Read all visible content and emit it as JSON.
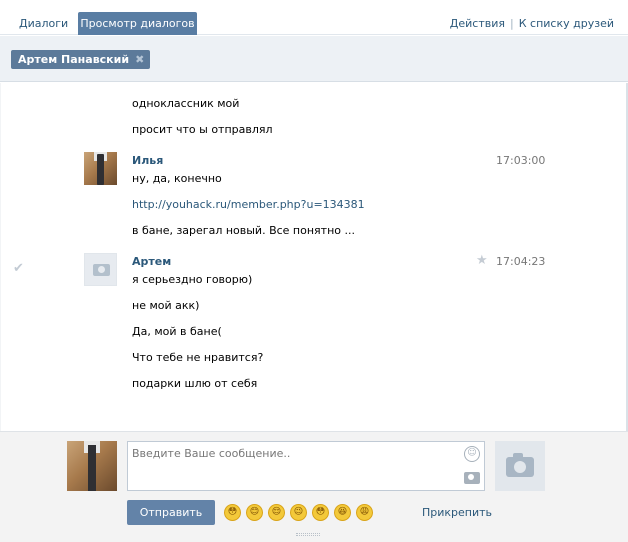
{
  "tabs": [
    {
      "label": "Диалоги",
      "active": false
    },
    {
      "label": "Просмотр диалогов",
      "active": true
    }
  ],
  "top_links": {
    "actions": "Действия",
    "separator": "|",
    "friends": "К списку друзей"
  },
  "peer": {
    "name": "Артем Панавский",
    "remove_icon": "close-icon",
    "remove_glyph": "✖"
  },
  "messages": [
    {
      "lines": [
        "одноклассник мой",
        "просит что ы отправлял"
      ]
    },
    {
      "author": "Илья",
      "time": "17:03:00",
      "avatar": "photo",
      "lines": [
        "ну, да, конечно",
        "http://youhack.ru/member.php?u=134381",
        "в бане, зарегал новый. Все понятно ..."
      ]
    },
    {
      "author": "Артем",
      "time": "17:04:23",
      "avatar": "camera-icon",
      "read_icon": "✔",
      "star_icon": "★",
      "lines": [
        "я серьездно говорю)",
        "не мой акк)",
        "Да, мой в бане(",
        "Что тебе не нравится?",
        "подарки шлю от себя"
      ]
    }
  ],
  "composer": {
    "placeholder": "Введите Ваше сообщение..",
    "send_label": "Отправить",
    "attach_label": "Прикрепить",
    "emojis": [
      "😳",
      "😊",
      "😌",
      "😉",
      "😳",
      "😆",
      "😩"
    ],
    "smile_glyph": "☺"
  },
  "colors": {
    "accent": "#597da3",
    "link": "#2b587a",
    "button": "#6383a8"
  }
}
